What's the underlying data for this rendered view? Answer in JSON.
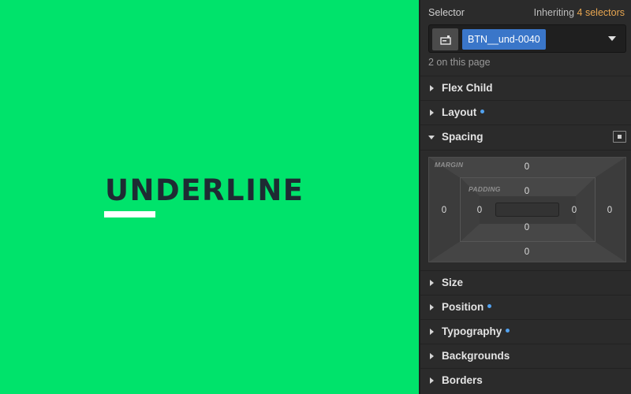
{
  "canvas": {
    "button_text": "UNDERLINE"
  },
  "selector": {
    "title": "Selector",
    "inheriting_prefix": "Inheriting",
    "inheriting_count": "4 selectors",
    "tag": "BTN__und-0040",
    "on_page": "2 on this page"
  },
  "sections": {
    "flex_child": "Flex Child",
    "layout": "Layout",
    "spacing": "Spacing",
    "size": "Size",
    "position": "Position",
    "typography": "Typography",
    "backgrounds": "Backgrounds",
    "borders": "Borders"
  },
  "spacing": {
    "margin_label": "MARGIN",
    "padding_label": "PADDING",
    "margin": {
      "top": "0",
      "right": "0",
      "bottom": "0",
      "left": "0"
    },
    "padding": {
      "top": "0",
      "right": "0",
      "bottom": "0",
      "left": "0"
    }
  },
  "colors": {
    "canvas_bg": "#00e36b",
    "text_dark": "#1e2b33",
    "selector_tag": "#3a76c9",
    "inheriting_accent": "#e8a650",
    "modified_dot": "#52a2f0"
  }
}
